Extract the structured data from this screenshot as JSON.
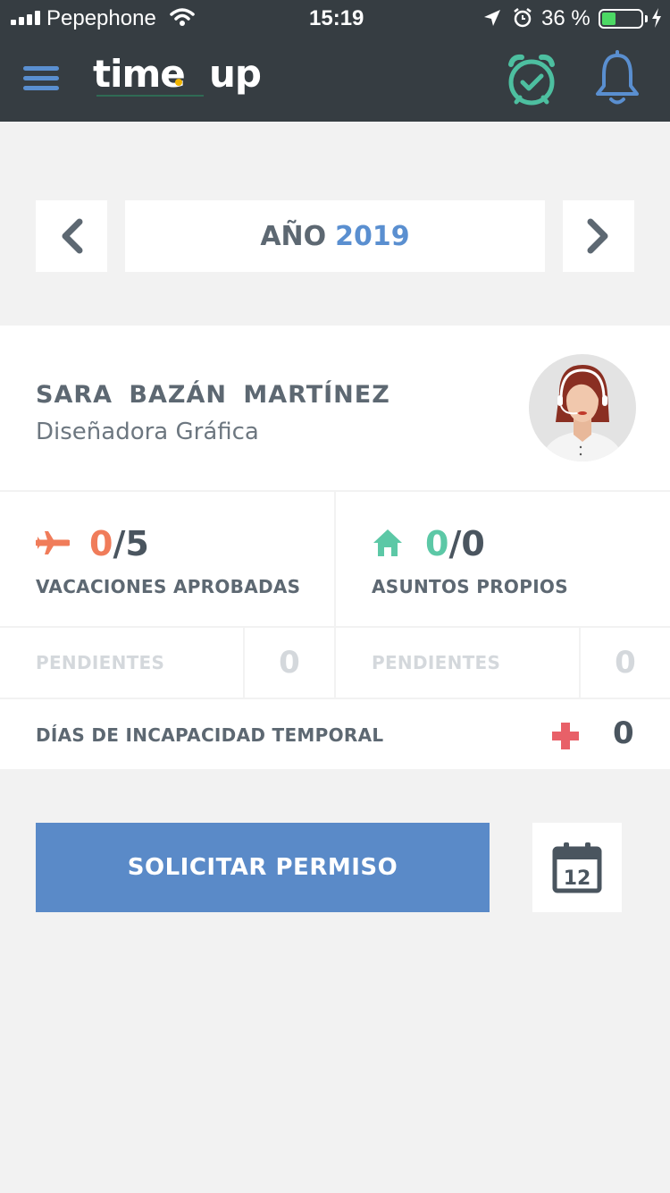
{
  "status_bar": {
    "carrier": "Pepephone",
    "time": "15:19",
    "battery": "36 %",
    "battery_level": 0.36
  },
  "header": {
    "logo": "time·up",
    "icons": [
      "menu-icon",
      "clock-check-icon",
      "bell-icon"
    ]
  },
  "year_selector": {
    "label": "AÑO",
    "year": "2019"
  },
  "profile": {
    "name": "SARA  BAZÁN  MARTÍNEZ",
    "role": "Diseñadora Gráfica"
  },
  "vacaciones": {
    "used": "0",
    "total": "/5",
    "label": "VACACIONES APROBADAS",
    "pending_label": "PENDIENTES",
    "pending_value": "0"
  },
  "asuntos": {
    "used": "0",
    "total": "/0",
    "label": "ASUNTOS PROPIOS",
    "pending_label": "PENDIENTES",
    "pending_value": "0"
  },
  "incapacidad": {
    "label": "DÍAS DE INCAPACIDAD TEMPORAL",
    "value": "0"
  },
  "actions": {
    "request_label": "SOLICITAR PERMISO",
    "calendar_day": "12"
  },
  "colors": {
    "header_bg": "#363d42",
    "accent_blue": "#5a8fd0",
    "vacation_orange": "#f07c5a",
    "asuntos_teal": "#5cc8a6",
    "cross_red": "#e86068",
    "clock_green": "#4dbfa0"
  }
}
